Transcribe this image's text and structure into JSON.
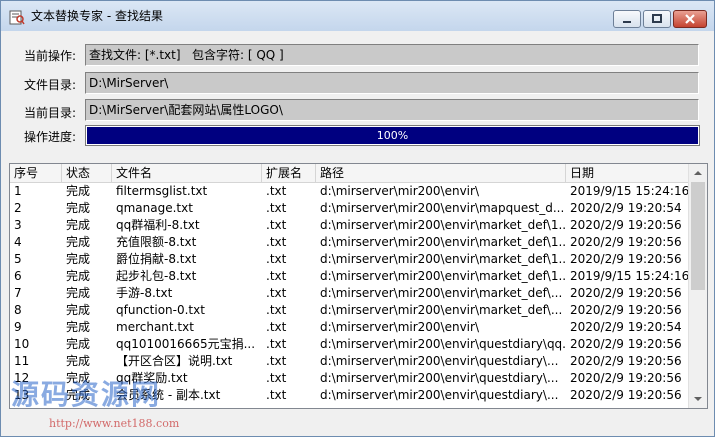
{
  "window": {
    "title": "文本替换专家 - 查找结果",
    "icon": "app-icon"
  },
  "form": {
    "operation_label": "当前操作:",
    "operation_value": "查找文件: [*.txt]   包含字符: [ QQ ]",
    "file_dir_label": "文件目录:",
    "file_dir_value": "D:\\MirServer\\",
    "current_dir_label": "当前目录:",
    "current_dir_value": "D:\\MirServer\\配套网站\\属性LOGO\\",
    "progress_label": "操作进度:",
    "progress_value": 100,
    "progress_text": "100%"
  },
  "list": {
    "columns": [
      "序号",
      "状态",
      "文件名",
      "扩展名",
      "路径",
      "日期"
    ],
    "rows": [
      [
        "1",
        "完成",
        "filtermsglist.txt",
        ".txt",
        "d:\\mirserver\\mir200\\envir\\",
        "2019/9/15 15:24:16"
      ],
      [
        "2",
        "完成",
        "qmanage.txt",
        ".txt",
        "d:\\mirserver\\mir200\\envir\\mapquest_d...",
        "2020/2/9 19:20:54"
      ],
      [
        "3",
        "完成",
        "qq群福利-8.txt",
        ".txt",
        "d:\\mirserver\\mir200\\envir\\market_def\\1...",
        "2020/2/9 19:20:56"
      ],
      [
        "4",
        "完成",
        "充值限额-8.txt",
        ".txt",
        "d:\\mirserver\\mir200\\envir\\market_def\\1...",
        "2020/2/9 19:20:56"
      ],
      [
        "5",
        "完成",
        "爵位捐献-8.txt",
        ".txt",
        "d:\\mirserver\\mir200\\envir\\market_def\\1...",
        "2020/2/9 19:20:56"
      ],
      [
        "6",
        "完成",
        "起步礼包-8.txt",
        ".txt",
        "d:\\mirserver\\mir200\\envir\\market_def\\1...",
        "2019/9/15 15:24:16"
      ],
      [
        "7",
        "完成",
        "手游-8.txt",
        ".txt",
        "d:\\mirserver\\mir200\\envir\\market_def\\...",
        "2020/2/9 19:20:56"
      ],
      [
        "8",
        "完成",
        "qfunction-0.txt",
        ".txt",
        "d:\\mirserver\\mir200\\envir\\market_def\\...",
        "2020/2/9 19:20:56"
      ],
      [
        "9",
        "完成",
        "merchant.txt",
        ".txt",
        "d:\\mirserver\\mir200\\envir\\",
        "2020/2/9 19:20:54"
      ],
      [
        "10",
        "完成",
        "qq1010016665元宝捐...",
        ".txt",
        "d:\\mirserver\\mir200\\envir\\questdiary\\qq...",
        "2020/2/9 19:20:56"
      ],
      [
        "11",
        "完成",
        "【开区合区】说明.txt",
        ".txt",
        "d:\\mirserver\\mir200\\envir\\questdiary\\...",
        "2020/2/9 19:20:56"
      ],
      [
        "12",
        "完成",
        "qq群奖励.txt",
        ".txt",
        "d:\\mirserver\\mir200\\envir\\questdiary\\...",
        "2020/2/9 19:20:56"
      ],
      [
        "13",
        "完成",
        "会员系统 - 副本.txt",
        ".txt",
        "d:\\mirserver\\mir200\\envir\\questdiary\\...",
        "2020/2/9 19:20:56"
      ]
    ]
  },
  "watermark": {
    "text": "源码资源网",
    "url": "http://www.net188.com"
  }
}
